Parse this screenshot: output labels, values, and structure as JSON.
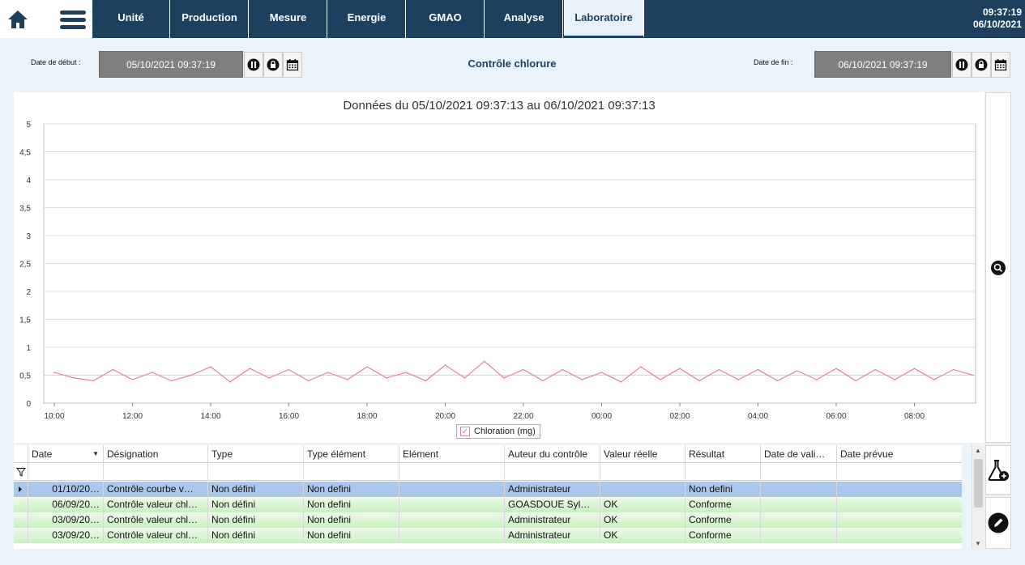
{
  "nav": {
    "tabs": [
      {
        "label": "Unité"
      },
      {
        "label": "Production"
      },
      {
        "label": "Mesure"
      },
      {
        "label": "Energie"
      },
      {
        "label": "GMAO"
      },
      {
        "label": "Analyse"
      },
      {
        "label": "Laboratoire",
        "active": true
      }
    ]
  },
  "clock": {
    "time": "09:37:19",
    "date": "06/10/2021"
  },
  "filters": {
    "start_label": "Date de début :",
    "start_value": "05/10/2021 09:37:19",
    "end_label": "Date de fin :",
    "end_value": "06/10/2021 09:37:19"
  },
  "page_title": "Contrôle chlorure",
  "chart_data": {
    "type": "line",
    "title": "Données du 05/10/2021 09:37:13 au 06/10/2021 09:37:13",
    "x_ticks": [
      "10:00",
      "12:00",
      "14:00",
      "16:00",
      "18:00",
      "20:00",
      "22:00",
      "00:00",
      "02:00",
      "04:00",
      "06:00",
      "08:00"
    ],
    "y_ticks": [
      "0",
      "0,5",
      "1",
      "1,5",
      "2",
      "2,5",
      "3",
      "3,5",
      "4",
      "4,5",
      "5"
    ],
    "ylim": [
      0,
      5
    ],
    "grid": true,
    "legend": "bottom-center",
    "series": [
      {
        "name": "Chloration (mg)",
        "color": "#e3849a",
        "x": [
          "10:00",
          "10:30",
          "11:00",
          "11:30",
          "12:00",
          "12:30",
          "13:00",
          "13:30",
          "14:00",
          "14:30",
          "15:00",
          "15:30",
          "16:00",
          "16:30",
          "17:00",
          "17:30",
          "18:00",
          "18:30",
          "19:00",
          "19:30",
          "20:00",
          "20:30",
          "21:00",
          "21:30",
          "22:00",
          "22:30",
          "23:00",
          "23:30",
          "00:00",
          "00:30",
          "01:00",
          "01:30",
          "02:00",
          "02:30",
          "03:00",
          "03:30",
          "04:00",
          "04:30",
          "05:00",
          "05:30",
          "06:00",
          "06:30",
          "07:00",
          "07:30",
          "08:00",
          "08:30",
          "09:00",
          "09:30"
        ],
        "values": [
          0.55,
          0.45,
          0.4,
          0.6,
          0.42,
          0.55,
          0.4,
          0.5,
          0.65,
          0.38,
          0.62,
          0.45,
          0.6,
          0.4,
          0.55,
          0.42,
          0.65,
          0.45,
          0.55,
          0.4,
          0.68,
          0.45,
          0.75,
          0.45,
          0.6,
          0.4,
          0.6,
          0.42,
          0.55,
          0.38,
          0.65,
          0.42,
          0.62,
          0.4,
          0.6,
          0.42,
          0.6,
          0.4,
          0.58,
          0.42,
          0.62,
          0.4,
          0.6,
          0.42,
          0.62,
          0.42,
          0.6,
          0.5
        ]
      }
    ]
  },
  "table": {
    "columns": [
      "Date",
      "Désignation",
      "Type",
      "Type élément",
      "Elément",
      "Auteur du contrôle",
      "Valeur réelle",
      "Résultat",
      "Date de vali…",
      "Date prévue"
    ],
    "rows": [
      {
        "cells": [
          "01/10/20…",
          "Contrôle courbe v…",
          "Non défini",
          "Non defini",
          "",
          "Administrateur",
          "",
          "Non defini",
          "",
          ""
        ],
        "state": "selected"
      },
      {
        "cells": [
          "06/09/20…",
          "Contrôle valeur chl…",
          "Non défini",
          "Non defini",
          "",
          "GOASDOUE Syl…",
          "OK",
          "Conforme",
          "",
          ""
        ],
        "state": "ok"
      },
      {
        "cells": [
          "03/09/20…",
          "Contrôle valeur chl…",
          "Non défini",
          "Non defini",
          "",
          "Administrateur",
          "OK",
          "Conforme",
          "",
          ""
        ],
        "state": "ok"
      },
      {
        "cells": [
          "03/09/20…",
          "Contrôle valeur chl…",
          "Non défini",
          "Non defini",
          "",
          "Administrateur",
          "OK",
          "Conforme",
          "",
          ""
        ],
        "state": "ok"
      }
    ]
  },
  "icons": {
    "home": "home-icon",
    "menu": "hamburger-menu-icon",
    "pause": "pause-icon",
    "lock": "lock-icon",
    "calendar": "calendar-icon",
    "zoom": "zoom-icon",
    "add_lab": "lab-flask-add-icon",
    "edit": "edit-pencil-icon"
  },
  "colors": {
    "nav_bg": "#1e3f5e",
    "series": "#e3849a",
    "selected_row": "#a9c8ec",
    "ok_row": "#c9efc2"
  }
}
